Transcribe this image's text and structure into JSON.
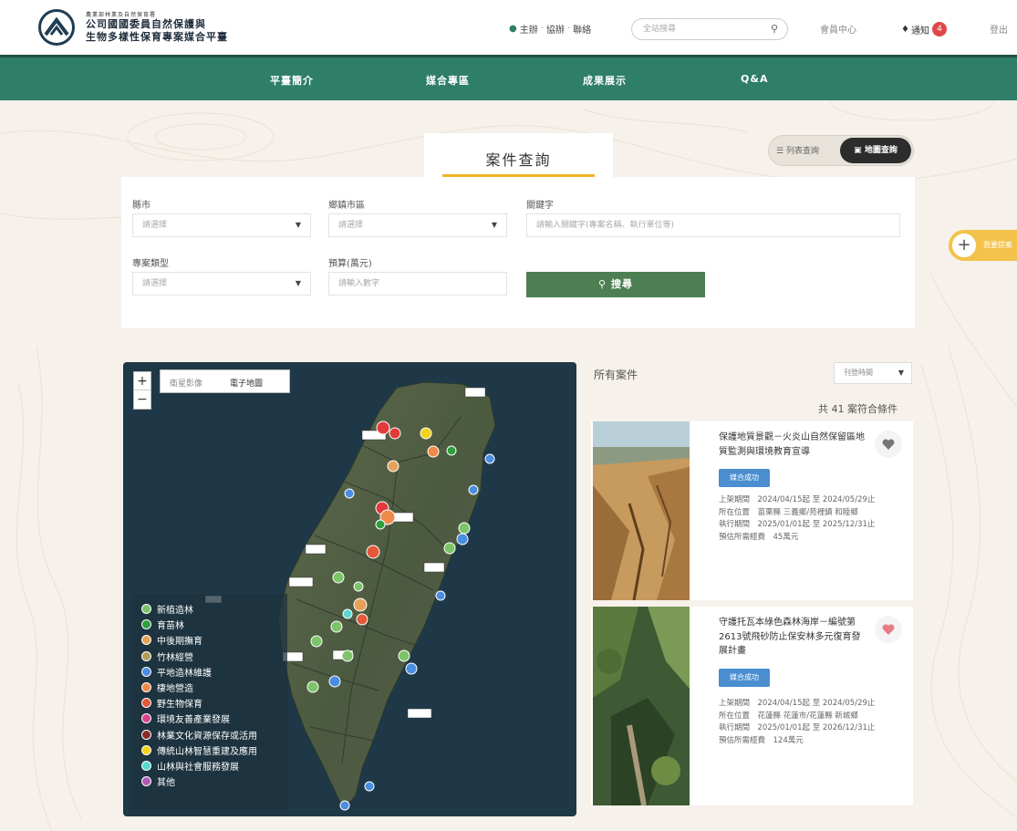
{
  "header": {
    "logo_small": "農業部林業及自然保育署",
    "logo_line1": "公司國國委員自然保護與",
    "logo_line2": "生物多樣性保育專案媒合平臺",
    "util_links": [
      "主辦",
      "協辦",
      "聯絡"
    ],
    "search_placeholder": "全站搜尋",
    "member_label": "會員中心",
    "notify_label": "通知",
    "notify_count": "4",
    "login_label": "登出"
  },
  "nav": {
    "items": [
      "平臺簡介",
      "媒合專區",
      "成果展示",
      "Q&A"
    ]
  },
  "page": {
    "tab_title": "案件查詢",
    "view_list_label": "列表查詢",
    "view_map_label": "地圖查詢",
    "float_label": "我要提案"
  },
  "filters": {
    "county_label": "縣市",
    "county_value": "請選擇",
    "district_label": "鄉鎮市區",
    "district_value": "請選擇",
    "keyword_label": "關鍵字",
    "keyword_placeholder": "請輸入關鍵字(專案名稱、執行單位等)",
    "type_label": "專案類型",
    "type_value": "請選擇",
    "budget_label": "預算(萬元)",
    "budget_placeholder": "請輸入數字",
    "search_button": "搜尋"
  },
  "map": {
    "zoom_in": "+",
    "zoom_out": "−",
    "type_satellite": "衛星影像",
    "type_electronic": "電子地圖",
    "legend": [
      {
        "label": "新植造林",
        "color": "#7cc36a"
      },
      {
        "label": "育苗林",
        "color": "#2e9e3e"
      },
      {
        "label": "中後期撫育",
        "color": "#e6a25a"
      },
      {
        "label": "竹林經營",
        "color": "#b59b58"
      },
      {
        "label": "平地造林維護",
        "color": "#4b8de0"
      },
      {
        "label": "棲地營造",
        "color": "#f08a4a"
      },
      {
        "label": "野生物保育",
        "color": "#e25a3a"
      },
      {
        "label": "環境友善產業發展",
        "color": "#d9428a"
      },
      {
        "label": "林業文化資源保存或活用",
        "color": "#8a2a2a"
      },
      {
        "label": "傳統山林智慧重建及應用",
        "color": "#f2d21a"
      },
      {
        "label": "山林與社會服務發展",
        "color": "#5ad8d0"
      },
      {
        "label": "其他",
        "color": "#b05ab8"
      }
    ]
  },
  "results": {
    "title": "所有案件",
    "sort_value": "刊登時間",
    "count_text": "共 41 案符合條件",
    "cards": [
      {
        "title": "保護地質景觀－火炎山自然保留區地質監測與環境教育宣導",
        "tag": "媒合成功",
        "line1": "上架期間　2024/04/15起 至 2024/05/29止",
        "line2": "所在位置　苗栗縣 三義鄉/苑裡鎮 和睦鄉",
        "line3": "執行期間　2025/01/01起 至 2025/12/31止",
        "line4": "預估所需經費　45萬元",
        "heart_color": "#777777"
      },
      {
        "title": "守護托瓦本綠色森林海岸－編號第2613號飛砂防止保安林多元復育發展計畫",
        "tag": "媒合成功",
        "line1": "上架期間　2024/04/15起 至 2024/05/29止",
        "line2": "所在位置　花蓮縣 花蓮市/花蓮縣 新城鄉",
        "line3": "執行期間　2025/01/01起 至 2026/12/31止",
        "line4": "預估所需經費　124萬元",
        "heart_color": "#e97b86"
      }
    ]
  }
}
